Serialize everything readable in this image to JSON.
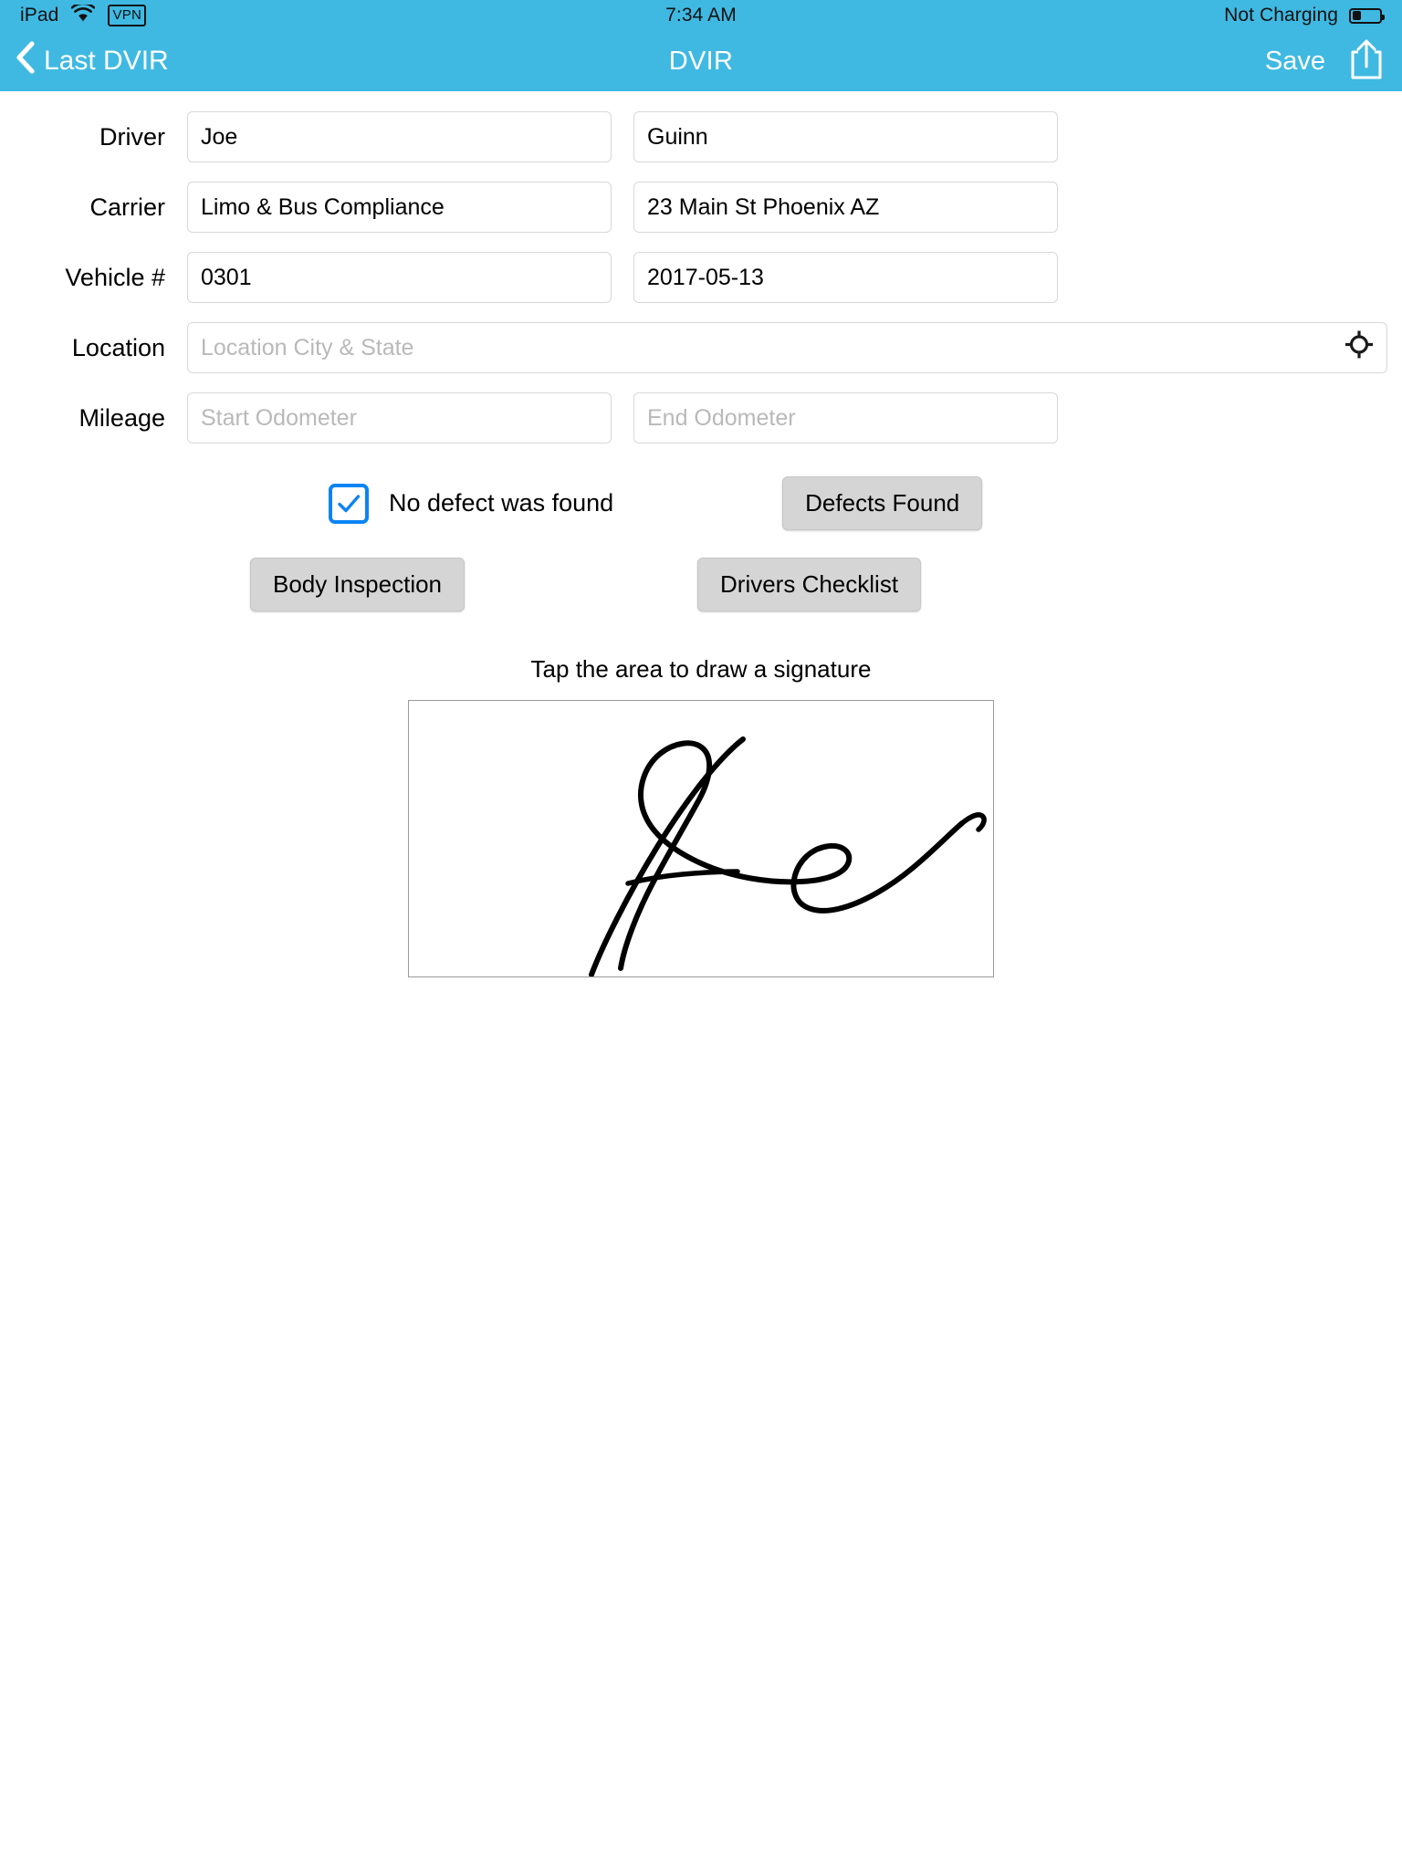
{
  "status_bar": {
    "device": "iPad",
    "wifi_icon": "wifi-icon",
    "vpn_label": "VPN",
    "time": "7:34 AM",
    "battery_text": "Not Charging",
    "battery_icon": "battery-icon",
    "battery_percent": 30
  },
  "nav_bar": {
    "back_icon": "chevron-left-icon",
    "back_label": "Last DVIR",
    "title": "DVIR",
    "save_label": "Save",
    "share_icon": "share-icon"
  },
  "colors": {
    "nav_background": "#3fb9e2",
    "checkbox_blue": "#0b84f3",
    "button_gray": "#d5d5d5",
    "field_border": "#d8d8d8",
    "placeholder": "#b9b9b9"
  },
  "form": {
    "rows": [
      {
        "label": "Driver",
        "left": {
          "value": "Joe",
          "placeholder": ""
        },
        "right": {
          "value": "Guinn",
          "placeholder": ""
        }
      },
      {
        "label": "Carrier",
        "left": {
          "value": "Limo & Bus Compliance",
          "placeholder": ""
        },
        "right": {
          "value": "23 Main St Phoenix AZ",
          "placeholder": ""
        }
      },
      {
        "label": "Vehicle #",
        "left": {
          "value": "0301",
          "placeholder": ""
        },
        "right": {
          "value": "2017-05-13",
          "placeholder": ""
        }
      }
    ],
    "location": {
      "label": "Location",
      "value": "",
      "placeholder": "Location City & State",
      "gps_icon": "gps-crosshair-icon"
    },
    "mileage": {
      "label": "Mileage",
      "start": {
        "value": "",
        "placeholder": "Start Odometer"
      },
      "end": {
        "value": "",
        "placeholder": "End Odometer"
      }
    }
  },
  "controls": {
    "no_defect_label": "No defect was found",
    "no_defect_checked": true,
    "defects_found_label": "Defects Found",
    "body_inspection_label": "Body Inspection",
    "drivers_checklist_label": "Drivers Checklist"
  },
  "signature": {
    "caption": "Tap the area to draw a signature",
    "has_signature": true
  }
}
